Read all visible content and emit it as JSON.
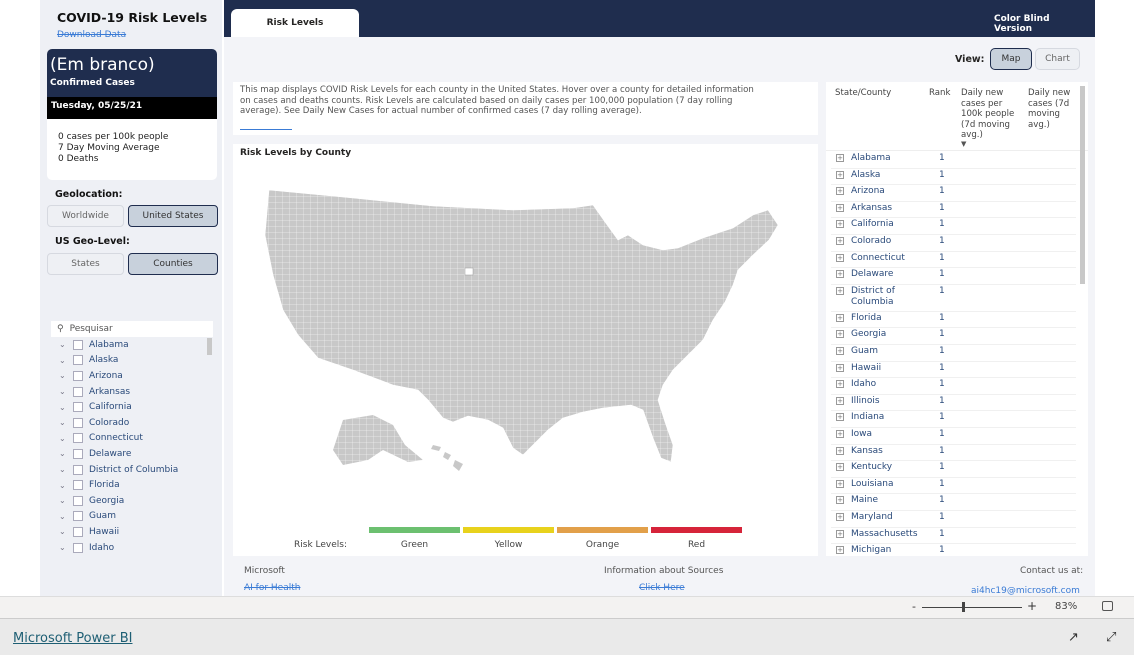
{
  "sidebar": {
    "title": "COVID-19 Risk Levels",
    "download_link": "Download Data",
    "card": {
      "name": "(Em branco)",
      "subtitle": "Confirmed Cases",
      "date": "Tuesday, 05/25/21",
      "stat1": "0 cases per 100k people",
      "stat2": "7 Day Moving Average",
      "stat3": "0 Deaths"
    },
    "geolocation_label": "Geolocation:",
    "geo_options": [
      "Worldwide",
      "United States"
    ],
    "geo_selected": "United States",
    "geolevel_label": "US Geo-Level:",
    "level_options": [
      "States",
      "Counties"
    ],
    "level_selected": "Counties",
    "search_placeholder": "Pesquisar",
    "states": [
      "Alabama",
      "Alaska",
      "Arizona",
      "Arkansas",
      "California",
      "Colorado",
      "Connecticut",
      "Delaware",
      "District of Columbia",
      "Florida",
      "Georgia",
      "Guam",
      "Hawaii",
      "Idaho"
    ]
  },
  "header": {
    "tab": "Risk Levels",
    "color_blind": "Color Blind Version"
  },
  "view": {
    "label": "View:",
    "options": [
      "Map",
      "Chart"
    ],
    "selected": "Map"
  },
  "description": "This map displays COVID Risk Levels for each county in the United States. Hover over a county for detailed information on cases and deaths counts. Risk Levels are calculated based on daily cases per 100,000 population (7 day rolling average). See Daily New Cases for actual number of confirmed cases (7 day rolling average).",
  "map": {
    "title": "Risk Levels by County",
    "fill_color": "#c8c8c8",
    "legend_label": "Risk Levels:",
    "legend": [
      {
        "label": "Green",
        "color": "#6cc070"
      },
      {
        "label": "Yellow",
        "color": "#e8d21d"
      },
      {
        "label": "Orange",
        "color": "#e2a04a"
      },
      {
        "label": "Red",
        "color": "#d6243a"
      }
    ]
  },
  "table": {
    "headers": [
      "State/County",
      "Rank",
      "Daily new cases per 100k people (7d moving avg.)",
      "Daily new cases (7d moving avg.)"
    ],
    "rows": [
      {
        "name": "Alabama",
        "rank": "1"
      },
      {
        "name": "Alaska",
        "rank": "1"
      },
      {
        "name": "Arizona",
        "rank": "1"
      },
      {
        "name": "Arkansas",
        "rank": "1"
      },
      {
        "name": "California",
        "rank": "1"
      },
      {
        "name": "Colorado",
        "rank": "1"
      },
      {
        "name": "Connecticut",
        "rank": "1"
      },
      {
        "name": "Delaware",
        "rank": "1"
      },
      {
        "name": "District of Columbia",
        "rank": "1"
      },
      {
        "name": "Florida",
        "rank": "1"
      },
      {
        "name": "Georgia",
        "rank": "1"
      },
      {
        "name": "Guam",
        "rank": "1"
      },
      {
        "name": "Hawaii",
        "rank": "1"
      },
      {
        "name": "Idaho",
        "rank": "1"
      },
      {
        "name": "Illinois",
        "rank": "1"
      },
      {
        "name": "Indiana",
        "rank": "1"
      },
      {
        "name": "Iowa",
        "rank": "1"
      },
      {
        "name": "Kansas",
        "rank": "1"
      },
      {
        "name": "Kentucky",
        "rank": "1"
      },
      {
        "name": "Louisiana",
        "rank": "1"
      },
      {
        "name": "Maine",
        "rank": "1"
      },
      {
        "name": "Maryland",
        "rank": "1"
      },
      {
        "name": "Massachusetts",
        "rank": "1"
      },
      {
        "name": "Michigan",
        "rank": "1"
      }
    ]
  },
  "footer": {
    "microsoft": "Microsoft",
    "ai_link": "AI for Health",
    "sources": "Information about Sources",
    "click_here": "Click Here",
    "contact": "Contact us at:",
    "email": "ai4hc19@microsoft.com"
  },
  "status": {
    "zoom": "83%",
    "zoom_fraction": 0.5
  },
  "bottom": {
    "powerbi": "Microsoft Power BI"
  }
}
